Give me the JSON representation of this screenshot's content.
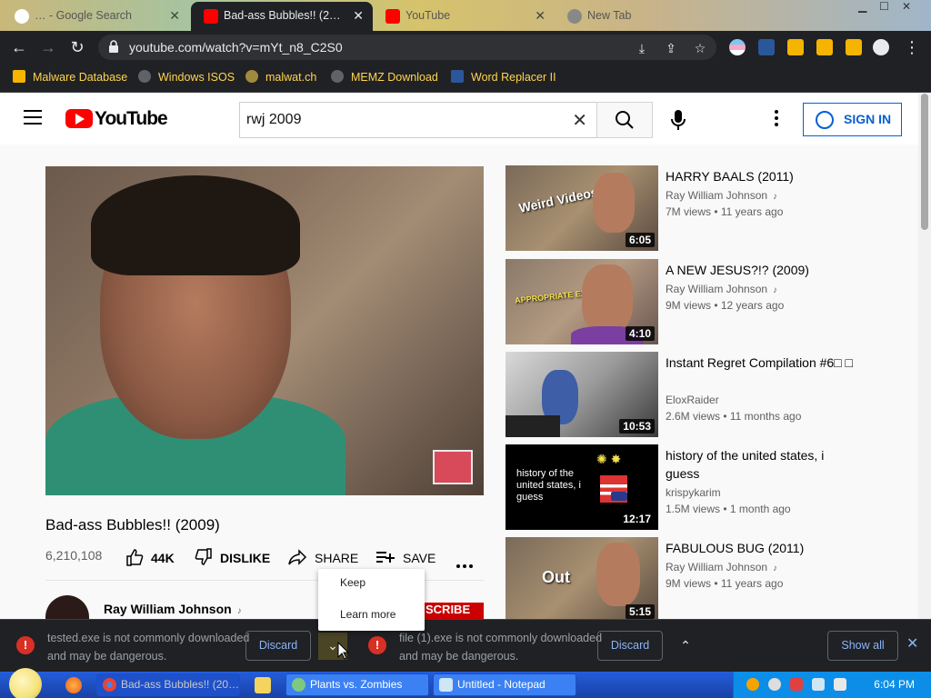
{
  "browser": {
    "tabs": [
      {
        "label": "… - Google Search",
        "active": false
      },
      {
        "label": "Bad-ass Bubbles!! (2…",
        "active": true
      },
      {
        "label": "YouTube",
        "active": false
      },
      {
        "label": "New Tab",
        "active": false
      }
    ],
    "url": "youtube.com/watch?v=mYt_n8_C2S0",
    "bookmarks": [
      "Malware Database",
      "Windows ISOS",
      "malwat.ch",
      "MEMZ Download",
      "Word Replacer II"
    ]
  },
  "youtube": {
    "logo_text": "YouTube",
    "search_query": "rwj 2009",
    "sign_in_label": "SIGN IN",
    "video": {
      "title": "Bad-ass Bubbles!! (2009)",
      "views": "6,210,108",
      "likes": "44K",
      "dislike_label": "DISLIKE",
      "share_label": "SHARE",
      "save_label": "SAVE",
      "channel": "Ray William Johnson",
      "subscribe_label": "SCRIBE"
    },
    "related": [
      {
        "title": "HARRY BAALS (2011)",
        "channel": "Ray William Johnson",
        "meta": "7M views • 11 years ago",
        "duration": "6:05",
        "overlay": "Weird Videos",
        "verified_music": true
      },
      {
        "title": "A NEW JESUS?!? (2009)",
        "channel": "Ray William Johnson",
        "meta": "9M views • 12 years ago",
        "duration": "4:10",
        "overlay": "APPROPRIATE EXIT!",
        "verified_music": true
      },
      {
        "title": "Instant Regret Compilation #6□ □",
        "channel": "EloxRaider",
        "meta": "2.6M views • 11 months ago",
        "duration": "10:53",
        "overlay": "",
        "verified_music": false
      },
      {
        "title": "history of the united states, i guess",
        "channel": "krispykarim",
        "meta": "1.5M views • 1 month ago",
        "duration": "12:17",
        "overlay": "history of the united states, i guess",
        "verified_music": false
      },
      {
        "title": "FABULOUS BUG (2011)",
        "channel": "Ray William Johnson",
        "meta": "9M views • 11 years ago",
        "duration": "5:15",
        "overlay": "Out",
        "verified_music": true
      }
    ]
  },
  "popup_menu": {
    "items": [
      "Keep",
      "Learn more"
    ]
  },
  "downloads": {
    "items": [
      {
        "text": "tested.exe is not commonly downloaded and may be dangerous.",
        "discard_label": "Discard"
      },
      {
        "text": "file (1).exe is not commonly downloaded and may be dangerous.",
        "discard_label": "Discard"
      }
    ],
    "show_all_label": "Show all"
  },
  "taskbar": {
    "tasks": [
      {
        "label": "Bad-ass Bubbles!! (20…",
        "active": true
      },
      {
        "label": "Plants vs. Zombies",
        "active": false
      },
      {
        "label": "Untitled - Notepad",
        "active": false
      }
    ],
    "clock": "6:04 PM"
  },
  "colors": {
    "accent": "#065fd4",
    "youtube_red": "#ff0000",
    "warning": "#d93025",
    "bookmark_text": "#ffd54f"
  }
}
